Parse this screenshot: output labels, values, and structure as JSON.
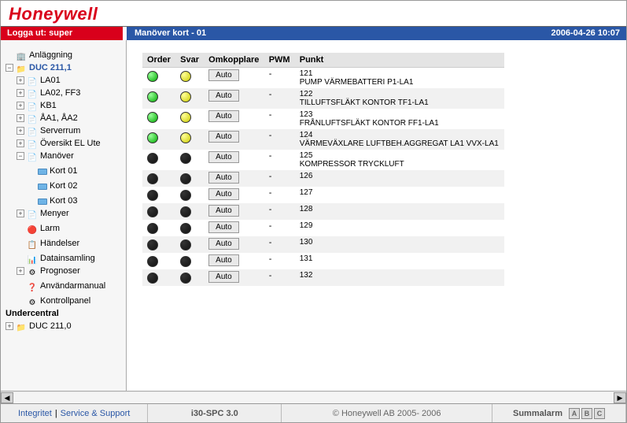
{
  "brand": "Honeywell",
  "header": {
    "logout": "Logga ut: super",
    "title": "Manöver kort - 01",
    "datetime": "2006-04-26 10:07"
  },
  "tree": {
    "root": "Anläggning",
    "duc": "DUC 211,1",
    "items": [
      {
        "label": "LA01",
        "exp": "+",
        "ic": "page"
      },
      {
        "label": "LA02, FF3",
        "exp": "+",
        "ic": "page"
      },
      {
        "label": "KB1",
        "exp": "+",
        "ic": "page"
      },
      {
        "label": "ÅA1, ÅA2",
        "exp": "+",
        "ic": "page"
      },
      {
        "label": "Serverrum",
        "exp": "+",
        "ic": "page"
      },
      {
        "label": "Översikt EL Ute",
        "exp": "+",
        "ic": "page"
      },
      {
        "label": "Manöver",
        "exp": "-",
        "ic": "page"
      }
    ],
    "cards": [
      {
        "label": "Kort 01"
      },
      {
        "label": "Kort 02"
      },
      {
        "label": "Kort 03"
      }
    ],
    "after": [
      {
        "label": "Menyer",
        "exp": "+",
        "ic": "page"
      },
      {
        "label": "Larm",
        "exp": "",
        "ic": "alarm"
      },
      {
        "label": "Händelser",
        "exp": "",
        "ic": "event"
      },
      {
        "label": "Datainsamling",
        "exp": "",
        "ic": "data"
      },
      {
        "label": "Prognoser",
        "exp": "+",
        "ic": "prog"
      },
      {
        "label": "Användarmanual",
        "exp": "",
        "ic": "help"
      },
      {
        "label": "Kontrollpanel",
        "exp": "",
        "ic": "panel"
      }
    ],
    "under": "Undercentral",
    "duc2": "DUC 211,0"
  },
  "table": {
    "headers": [
      "Order",
      "Svar",
      "Omkopplare",
      "PWM",
      "Punkt"
    ],
    "auto_label": "Auto",
    "rows": [
      {
        "order": "green",
        "svar": "yellow",
        "pwm": "-",
        "num": "121",
        "desc": "PUMP VÄRMEBATTERI P1-LA1"
      },
      {
        "order": "green",
        "svar": "yellow",
        "pwm": "-",
        "num": "122",
        "desc": "TILLUFTSFLÄKT KONTOR TF1-LA1"
      },
      {
        "order": "green",
        "svar": "yellow",
        "pwm": "-",
        "num": "123",
        "desc": "FRÅNLUFTSFLÄKT KONTOR FF1-LA1"
      },
      {
        "order": "green",
        "svar": "yellow",
        "pwm": "-",
        "num": "124",
        "desc": "VÄRMEVÄXLARE LUFTBEH.AGGREGAT LA1 VVX-LA1"
      },
      {
        "order": "off",
        "svar": "off",
        "pwm": "-",
        "num": "125",
        "desc": "KOMPRESSOR TRYCKLUFT"
      },
      {
        "order": "off",
        "svar": "off",
        "pwm": "-",
        "num": "126",
        "desc": ""
      },
      {
        "order": "off",
        "svar": "off",
        "pwm": "-",
        "num": "127",
        "desc": ""
      },
      {
        "order": "off",
        "svar": "off",
        "pwm": "-",
        "num": "128",
        "desc": ""
      },
      {
        "order": "off",
        "svar": "off",
        "pwm": "-",
        "num": "129",
        "desc": ""
      },
      {
        "order": "off",
        "svar": "off",
        "pwm": "-",
        "num": "130",
        "desc": ""
      },
      {
        "order": "off",
        "svar": "off",
        "pwm": "-",
        "num": "131",
        "desc": ""
      },
      {
        "order": "off",
        "svar": "off",
        "pwm": "-",
        "num": "132",
        "desc": ""
      }
    ]
  },
  "footer": {
    "link1": "Integritet",
    "link2": "Service & Support",
    "product": "i30-SPC 3.0",
    "copyright": "© Honeywell AB 2005- 2006",
    "summalarm": "Summalarm",
    "badges": [
      "A",
      "B",
      "C"
    ]
  }
}
